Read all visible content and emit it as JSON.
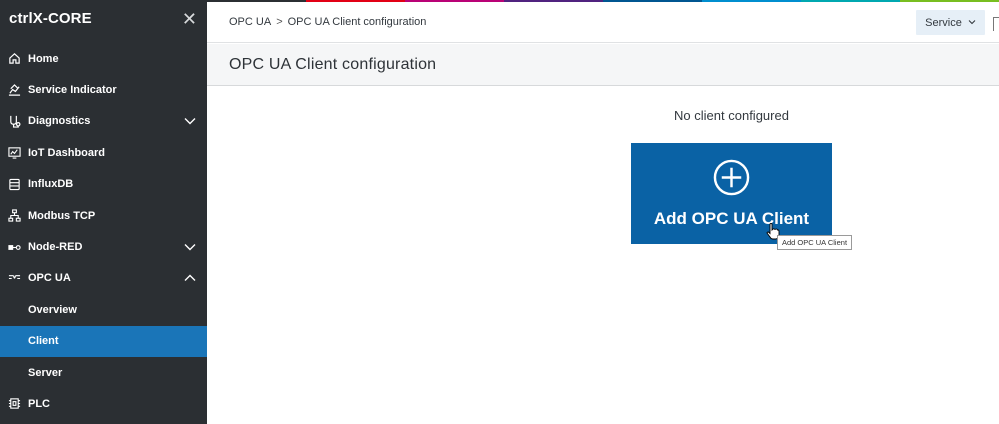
{
  "app": {
    "title": "ctrlX-CORE"
  },
  "top_strip_colors": [
    "#2b2f33",
    "#e20015",
    "#b90276",
    "#50237f",
    "#005691",
    "#008ecf",
    "#00a8b0",
    "#78be20"
  ],
  "sidebar": {
    "items": [
      {
        "label": "Home",
        "icon": "home-icon"
      },
      {
        "label": "Service Indicator",
        "icon": "service-indicator-icon"
      },
      {
        "label": "Diagnostics",
        "icon": "diagnostics-icon",
        "expanded": false
      },
      {
        "label": "IoT Dashboard",
        "icon": "dashboard-icon"
      },
      {
        "label": "InfluxDB",
        "icon": "database-icon"
      },
      {
        "label": "Modbus TCP",
        "icon": "network-icon"
      },
      {
        "label": "Node-RED",
        "icon": "node-red-icon",
        "expanded": false
      },
      {
        "label": "OPC UA",
        "icon": "opc-ua-icon",
        "expanded": true
      },
      {
        "label": "Overview"
      },
      {
        "label": "Client",
        "active": true
      },
      {
        "label": "Server"
      },
      {
        "label": "PLC",
        "icon": "plc-icon"
      }
    ]
  },
  "breadcrumb": {
    "items": [
      "OPC UA",
      "OPC UA Client configuration"
    ],
    "separator": ">"
  },
  "header": {
    "service_label": "Service"
  },
  "page": {
    "title": "OPC UA Client configuration",
    "empty_message": "No client configured",
    "add_button_label": "Add OPC UA Client",
    "tooltip": "Add OPC UA Client"
  },
  "colors": {
    "sidebar_bg": "#2b2f33",
    "active_item": "#1a75b8",
    "primary_button": "#0a62a5",
    "service_button_bg": "#e6eff7"
  }
}
